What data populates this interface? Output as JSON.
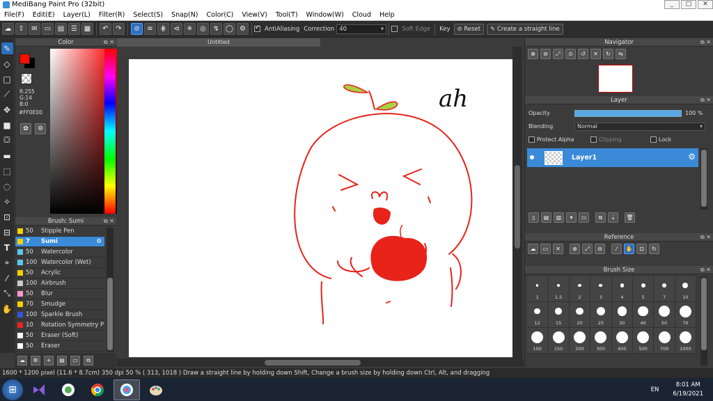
{
  "window": {
    "title": "MediBang Paint Pro (32bit)",
    "controls": [
      "_",
      "□",
      "✕"
    ]
  },
  "menu": [
    "File(F)",
    "Edit(E)",
    "Layer(L)",
    "Filter(R)",
    "Select(S)",
    "Snap(N)",
    "Color(C)",
    "View(V)",
    "Tool(T)",
    "Window(W)",
    "Cloud",
    "Help"
  ],
  "toolbar": {
    "antialiasing_label": "AntiAliasing",
    "correction_label": "Correction",
    "correction_value": "40",
    "soft_edge_label": "Soft Edge",
    "key_label": "Key",
    "reset_label": "Reset",
    "straight_line_label": "Create a straight line"
  },
  "color_panel": {
    "title": "Color",
    "rgb_text": "R:255\nG:14\nB:0",
    "hex": "#FF0E00",
    "fg_color": "#ff0e00"
  },
  "brush_panel": {
    "title": "Brush: Sumi",
    "items": [
      {
        "size": "50",
        "name": "Stipple Pen",
        "color": "#f5d000"
      },
      {
        "size": "7",
        "name": "Sumi",
        "color": "#f5d000",
        "selected": true
      },
      {
        "size": "50",
        "name": "Watercolor",
        "color": "#5ac8f0"
      },
      {
        "size": "100",
        "name": "Watercolor (Wet)",
        "color": "#5ac8f0"
      },
      {
        "size": "50",
        "name": "Acrylic",
        "color": "#f5d000"
      },
      {
        "size": "100",
        "name": "Airbrush",
        "color": "#cccccc"
      },
      {
        "size": "50",
        "name": "Blur",
        "color": "#ff99cc"
      },
      {
        "size": "70",
        "name": "Smudge",
        "color": "#f5d000"
      },
      {
        "size": "100",
        "name": "Sparkle Brush",
        "color": "#3355dd"
      },
      {
        "size": "10",
        "name": "Rotation Symmetry P",
        "color": "#ee2222"
      },
      {
        "size": "50",
        "name": "Eraser (Soft)",
        "color": "#ffffff"
      },
      {
        "size": "50",
        "name": "Eraser",
        "color": "#ffffff"
      }
    ]
  },
  "canvas": {
    "tab_title": "Untitled",
    "handwriting": "ah"
  },
  "navigator": {
    "title": "Navigator"
  },
  "layer_panel": {
    "title": "Layer",
    "opacity_label": "Opacity",
    "opacity_value": "100 %",
    "blending_label": "Blending",
    "blending_value": "Normal",
    "protect_alpha_label": "Protect Alpha",
    "clipping_label": "Clipping",
    "lock_label": "Lock",
    "layer_name": "Layer1"
  },
  "reference_panel": {
    "title": "Reference"
  },
  "brush_size_panel": {
    "title": "Brush Size",
    "sizes": [
      "1",
      "1.5",
      "2",
      "3",
      "4",
      "5",
      "7",
      "10",
      "12",
      "15",
      "20",
      "25",
      "30",
      "40",
      "50",
      "70",
      "100",
      "150",
      "200",
      "300",
      "400",
      "500",
      "700",
      "1000"
    ]
  },
  "status": {
    "text": "1600 * 1200 pixel   (11.6 * 8.7cm)   350 dpi   50 %   ( 313, 1018 )   Draw a straight line by holding down Shift, Change a brush size by holding down Ctrl, Alt, and dragging"
  },
  "taskbar": {
    "lang": "EN",
    "time": "8:01 AM",
    "date": "6/19/2021"
  }
}
